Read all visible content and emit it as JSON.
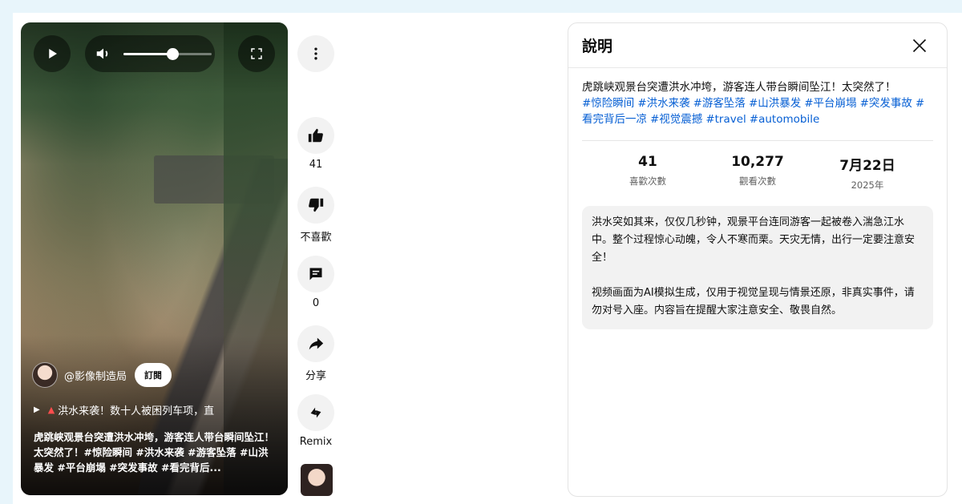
{
  "player": {
    "volume_level": 0.55,
    "channel": {
      "name": "@影像制造局",
      "subscribe_label": "訂閱"
    },
    "related_link": "洪水来袭！数十人被困列车项，直",
    "overlay_description": "虎跳峡观景台突遭洪水冲垮，游客连人带台瞬间坠江！太突然了！#惊险瞬间 #洪水来袭 #游客坠落 #山洪暴发 #平台崩塌 #突发事故 #看完背后..."
  },
  "actions": {
    "like_count": "41",
    "dislike_label": "不喜歡",
    "comment_count": "0",
    "share_label": "分享",
    "remix_label": "Remix"
  },
  "panel": {
    "title": "說明",
    "video_title": "虎跳峡观景台突遭洪水冲垮，游客连人带台瞬间坠江！太突然了！",
    "hashtags": [
      "#惊险瞬间",
      "#洪水来袭",
      "#游客坠落",
      "#山洪暴发",
      "#平台崩塌",
      "#突发事故",
      "#看完背后一凉",
      "#视觉震撼",
      "#travel",
      "#automobile"
    ],
    "stats": {
      "likes_value": "41",
      "likes_label": "喜歡次數",
      "views_value": "10,277",
      "views_label": "觀看次數",
      "date_value": "7月22日",
      "date_year": "2025年"
    },
    "description_p1": "洪水突如其来，仅仅几秒钟，观景平台连同游客一起被卷入湍急江水中。整个过程惊心动魄，令人不寒而栗。天灾无情，出行一定要注意安全！",
    "description_p2": "视频画面为AI模拟生成，仅用于视觉呈现与情景还原，非真实事件，请勿对号入座。内容旨在提醒大家注意安全、敬畏自然。"
  },
  "icons": {
    "play": "play-icon",
    "volume": "volume-icon",
    "fullscreen": "fullscreen-icon",
    "more": "more-vert-icon",
    "like": "thumb-up-icon",
    "dislike": "thumb-down-icon",
    "comment": "comment-icon",
    "share": "share-icon",
    "remix": "remix-icon",
    "close": "close-icon"
  },
  "colors": {
    "hashtag": "#065fd4",
    "page_bg": "#e8f5fb"
  }
}
